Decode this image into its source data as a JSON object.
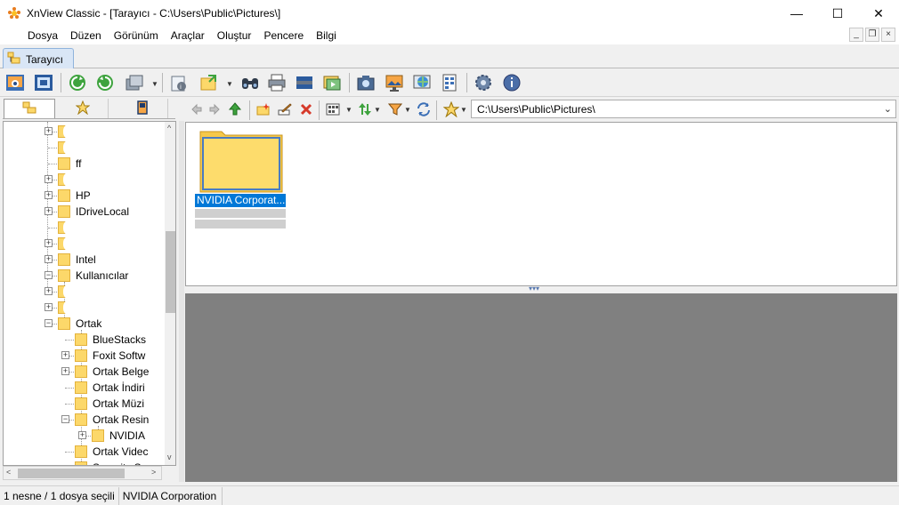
{
  "window": {
    "title": "XnView Classic - [Tarayıcı - C:\\Users\\Public\\Pictures\\]",
    "minimize_glyph": "—",
    "maximize_glyph": "☐",
    "close_glyph": "✕"
  },
  "menu": {
    "items": [
      "Dosya",
      "Düzen",
      "Görünüm",
      "Araçlar",
      "Oluştur",
      "Pencere",
      "Bilgi"
    ],
    "mdi_minimize": "_",
    "mdi_restore": "❐",
    "mdi_close": "×"
  },
  "tabs": [
    {
      "label": "Tarayıcı",
      "icon": "browser-icon"
    }
  ],
  "toolbar": {
    "buttons": [
      "open-browser-icon",
      "fullscreen-icon",
      "refresh-icon",
      "reload-icon",
      "batch-convert-icon",
      "properties-icon",
      "export-icon",
      "search-icon",
      "print-icon",
      "scan-icon",
      "slideshow-icon",
      "capture-icon",
      "set-wallpaper-icon",
      "web-icon",
      "contact-sheet-icon",
      "settings-icon",
      "info-icon"
    ]
  },
  "navbar": {
    "address": "C:\\Users\\Public\\Pictures\\",
    "dropdown_glyph": "⌄"
  },
  "tree": {
    "items": [
      {
        "label": "",
        "level": 0,
        "expander": "+"
      },
      {
        "label": "",
        "level": 0,
        "expander": ""
      },
      {
        "label": "ff",
        "level": 0,
        "expander": ""
      },
      {
        "label": "",
        "level": 0,
        "expander": "+"
      },
      {
        "label": "HP",
        "level": 0,
        "expander": "+"
      },
      {
        "label": "IDriveLocal",
        "level": 0,
        "expander": "+"
      },
      {
        "label": "",
        "level": 0,
        "expander": ""
      },
      {
        "label": "",
        "level": 0,
        "expander": "+"
      },
      {
        "label": "Intel",
        "level": 0,
        "expander": "+"
      },
      {
        "label": "Kullanıcılar",
        "level": 0,
        "expander": "−"
      },
      {
        "label": "",
        "level": 1,
        "expander": "+"
      },
      {
        "label": "",
        "level": 1,
        "expander": "+"
      },
      {
        "label": "Ortak",
        "level": 1,
        "expander": "−"
      },
      {
        "label": "BlueStacks",
        "level": 2,
        "expander": ""
      },
      {
        "label": "Foxit Softw",
        "level": 2,
        "expander": "+"
      },
      {
        "label": "Ortak Belge",
        "level": 2,
        "expander": "+"
      },
      {
        "label": "Ortak İndiri",
        "level": 2,
        "expander": ""
      },
      {
        "label": "Ortak Müzi",
        "level": 2,
        "expander": ""
      },
      {
        "label": "Ortak Resin",
        "level": 2,
        "expander": "−"
      },
      {
        "label": "NVIDIA",
        "level": 3,
        "expander": "+"
      },
      {
        "label": "Ortak Videc",
        "level": 2,
        "expander": ""
      },
      {
        "label": "Security So",
        "level": 2,
        "expander": ""
      }
    ]
  },
  "browser": {
    "items": [
      {
        "name": "NVIDIA Corporat...",
        "type": "folder",
        "selected": true
      }
    ]
  },
  "status": {
    "selection": "1 nesne / 1 dosya seçili",
    "current": "NVIDIA Corporation"
  },
  "colors": {
    "selection": "#0078d7",
    "folder": "#fcd86a",
    "preview_bg": "#808080"
  }
}
